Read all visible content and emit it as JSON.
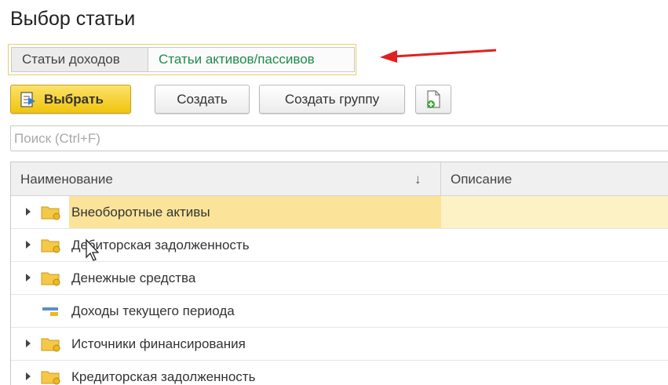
{
  "window": {
    "title": "Выбор статьи"
  },
  "tabs": [
    {
      "label": "Статьи доходов",
      "active": false
    },
    {
      "label": "Статьи активов/пассивов",
      "active": true
    }
  ],
  "toolbar": {
    "select_label": "Выбрать",
    "create_label": "Создать",
    "create_group_label": "Создать группу"
  },
  "search": {
    "placeholder": "Поиск (Ctrl+F)",
    "value": ""
  },
  "table": {
    "columns": {
      "name": "Наименование",
      "description": "Описание"
    },
    "sort_indicator": "↓",
    "rows": [
      {
        "name": "Внеоборотные активы",
        "type": "group",
        "selected": true
      },
      {
        "name": "Дебиторская задолженность",
        "type": "group",
        "selected": false
      },
      {
        "name": "Денежные средства",
        "type": "group",
        "selected": false
      },
      {
        "name": "Доходы текущего периода",
        "type": "item",
        "selected": false
      },
      {
        "name": "Источники финансирования",
        "type": "group",
        "selected": false
      },
      {
        "name": "Кредиторская задолженность",
        "type": "group",
        "selected": false
      }
    ]
  },
  "colors": {
    "active_tab_text": "#1f8a4c",
    "primary_button": "#f0c40c",
    "selected_row": "#fbe49a",
    "annotation_arrow": "#e02020"
  },
  "icons": {
    "select_button": "select-list-icon",
    "add_button": "add-document-icon",
    "group_row": "folder-icon",
    "item_row": "item-icon"
  }
}
